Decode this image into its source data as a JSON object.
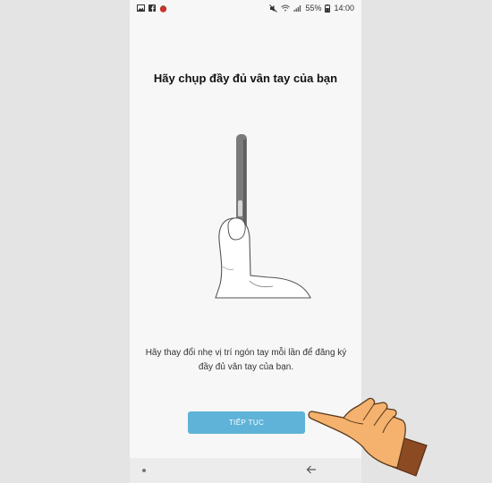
{
  "statusbar": {
    "icons_left": [
      "image-icon",
      "facebook-icon",
      "tomato-icon"
    ],
    "battery": "55%",
    "time": "14:00"
  },
  "screen": {
    "title": "Hãy chụp đầy đủ vân tay của bạn",
    "instruction": "Hãy thay đổi nhẹ vị trí ngón tay mỗi lần để đăng ký đầy đủ vân tay của bạn.",
    "continue_label": "TIẾP TỤC"
  },
  "colors": {
    "background": "#e4e4e4",
    "screen": "#f7f7f7",
    "accent_button": "#5fb3d8",
    "hand_skin": "#f4b26e",
    "hand_cuff": "#8b4a22"
  }
}
